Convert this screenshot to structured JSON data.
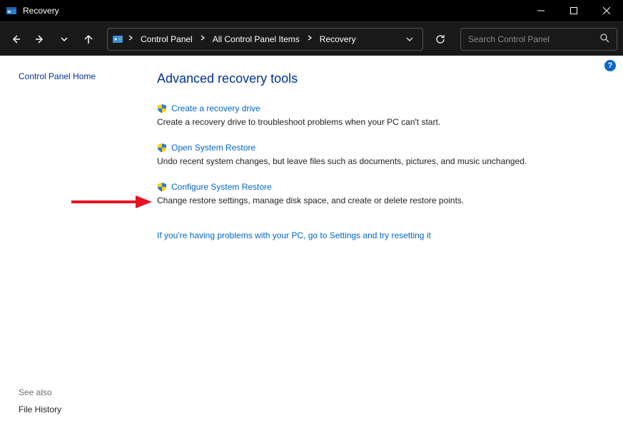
{
  "window": {
    "title": "Recovery"
  },
  "breadcrumbs": {
    "item0": "Control Panel",
    "item1": "All Control Panel Items",
    "item2": "Recovery"
  },
  "search": {
    "placeholder": "Search Control Panel"
  },
  "sidebar": {
    "home": "Control Panel Home",
    "see_also": "See also",
    "file_history": "File History"
  },
  "main": {
    "title": "Advanced recovery tools",
    "tools": {
      "t0": {
        "label": "Create a recovery drive",
        "desc": "Create a recovery drive to troubleshoot problems when your PC can't start."
      },
      "t1": {
        "label": "Open System Restore",
        "desc": "Undo recent system changes, but leave files such as documents, pictures, and music unchanged."
      },
      "t2": {
        "label": "Configure System Restore",
        "desc": "Change restore settings, manage disk space, and create or delete restore points."
      }
    },
    "settings_link": "If you're having problems with your PC, go to Settings and try resetting it"
  },
  "help": {
    "badge": "?"
  }
}
